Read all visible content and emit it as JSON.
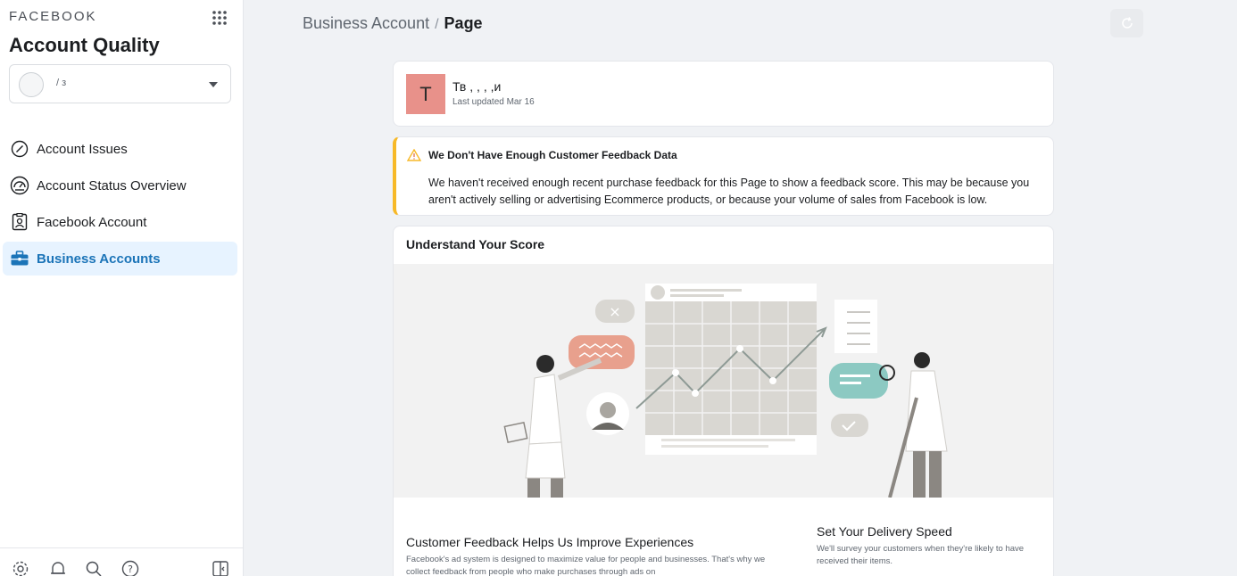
{
  "sidebar": {
    "brand": "FACEBOOK",
    "title": "Account Quality",
    "account_selector": {
      "name": "/ з"
    },
    "items": [
      {
        "label": "Account Issues",
        "icon": "slash-circle-icon",
        "active": false
      },
      {
        "label": "Account Status Overview",
        "icon": "speedometer-icon",
        "active": false
      },
      {
        "label": "Facebook Account",
        "icon": "id-badge-icon",
        "active": false
      },
      {
        "label": "Business Accounts",
        "icon": "briefcase-icon",
        "active": true
      }
    ],
    "footer_icons": [
      "settings-icon",
      "bell-icon",
      "search-icon",
      "help-icon",
      "collapse-panel-icon"
    ]
  },
  "header": {
    "breadcrumb": {
      "parent": "Business Account",
      "separator": "/",
      "current": "Page"
    }
  },
  "page_card": {
    "avatar_letter": "T",
    "name": "Тв ,         ,  ,                    ,и",
    "updated": "Last updated Mar 16"
  },
  "warning": {
    "title": "We Don't Have Enough Customer Feedback Data",
    "text": "We haven't received enough recent purchase feedback for this Page to show a feedback score. This may be because you aren't actively selling or advertising Ecommerce products, or because your volume of sales from Facebook is low."
  },
  "score": {
    "title": "Understand Your Score",
    "left_heading": "Customer Feedback Helps Us Improve Experiences",
    "left_text": "Facebook's ad system is designed to maximize value for people and businesses. That's why we collect feedback from people who make purchases through ads on",
    "right_heading": "Set Your Delivery Speed",
    "right_text": "We'll survey your customers when they're likely to have received their items."
  },
  "colors": {
    "accent": "#1b74b8",
    "active_bg": "#e7f3ff",
    "warning": "#f7b928",
    "avatar": "#e8918a"
  }
}
